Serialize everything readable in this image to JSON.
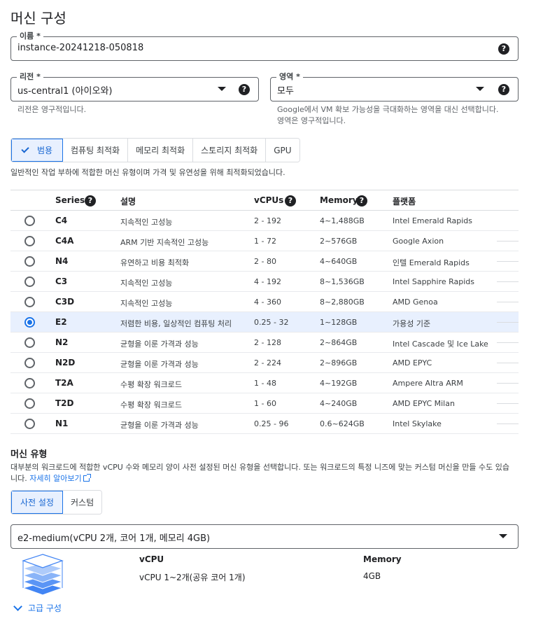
{
  "page_title": "머신 구성",
  "name_field": {
    "label": "이름 *",
    "value": "instance-20241218-050818",
    "help_icon": "help-icon"
  },
  "region_field": {
    "label": "리전 *",
    "value": "us-central1 (아이오와)",
    "hint": "리전은 영구적입니다."
  },
  "zone_field": {
    "label": "영역 *",
    "value": "모두",
    "hint_line1": "Google에서 VM 확보 가능성을 극대화하는 영역을 대신 선택합니다.",
    "hint_line2": "영역은 영구적입니다."
  },
  "family_tabs": [
    {
      "label": "범용"
    },
    {
      "label": "컴퓨팅 최적화"
    },
    {
      "label": "메모리 최적화"
    },
    {
      "label": "스토리지 최적화"
    },
    {
      "label": "GPU"
    }
  ],
  "family_description": "일반적인 작업 부하에 적합한 머신 유형이며 가격 및 유연성을 위해 최적화되었습니다.",
  "table": {
    "headers": {
      "series": "Series",
      "desc": "설명",
      "vcpus": "vCPUs",
      "memory": "Memory",
      "platform": "플랫폼"
    },
    "rows": [
      {
        "series": "C4",
        "desc": "지속적인 고성능",
        "vcpus": "2 - 192",
        "memory": "4~1,488GB",
        "platform": "Intel Emerald Rapids"
      },
      {
        "series": "C4A",
        "desc": "ARM 기반 지속적인 고성능",
        "vcpus": "1 - 72",
        "memory": "2~576GB",
        "platform": "Google Axion"
      },
      {
        "series": "N4",
        "desc": "유연하고 비용 최적화",
        "vcpus": "2 - 80",
        "memory": "4~640GB",
        "platform": "인텔 Emerald Rapids"
      },
      {
        "series": "C3",
        "desc": "지속적인 고성능",
        "vcpus": "4 - 192",
        "memory": "8~1,536GB",
        "platform": "Intel Sapphire Rapids"
      },
      {
        "series": "C3D",
        "desc": "지속적인 고성능",
        "vcpus": "4 - 360",
        "memory": "8~2,880GB",
        "platform": "AMD Genoa"
      },
      {
        "series": "E2",
        "desc": "저렴한 비용, 일상적인 컴퓨팅 처리",
        "vcpus": "0.25 - 32",
        "memory": "1~128GB",
        "platform": "가용성 기준"
      },
      {
        "series": "N2",
        "desc": "균형을 이룬 가격과 성능",
        "vcpus": "2 - 128",
        "memory": "2~864GB",
        "platform": "Intel Cascade 및 Ice Lake"
      },
      {
        "series": "N2D",
        "desc": "균형을 이룬 가격과 성능",
        "vcpus": "2 - 224",
        "memory": "2~896GB",
        "platform": "AMD EPYC"
      },
      {
        "series": "T2A",
        "desc": "수평 확장 워크로드",
        "vcpus": "1 - 48",
        "memory": "4~192GB",
        "platform": "Ampere Altra ARM"
      },
      {
        "series": "T2D",
        "desc": "수평 확장 워크로드",
        "vcpus": "1 - 60",
        "memory": "4~240GB",
        "platform": "AMD EPYC Milan"
      },
      {
        "series": "N1",
        "desc": "균형을 이룬 가격과 성능",
        "vcpus": "0.25 - 96",
        "memory": "0.6~624GB",
        "platform": "Intel Skylake"
      }
    ]
  },
  "machine_type": {
    "title": "머신 유형",
    "desc_line1": "대부분의 워크로드에 적합한 vCPU 수와 메모리 양이 사전 설정된 머신 유형을 선택합니다. 또는 워크로드의 특정 니즈에 맞는 커스텀 머신을 만들 수도 있습",
    "desc_line2_prefix": "니다.",
    "learn_more": "자세히 알아보기",
    "tabs": [
      {
        "label": "사전 설정"
      },
      {
        "label": "커스텀"
      }
    ],
    "selected": "e2-medium(vCPU 2개, 코어 1개, 메모리 4GB)",
    "vcpu_header": "vCPU",
    "vcpu_value": "vCPU 1~2개(공유 코어 1개)",
    "memory_header": "Memory",
    "memory_value": "4GB"
  },
  "advanced_label": "고급 구성",
  "colors": {
    "accent": "#1a73e8",
    "selected_bg": "#e8f0fe",
    "border": "#dadce0"
  }
}
